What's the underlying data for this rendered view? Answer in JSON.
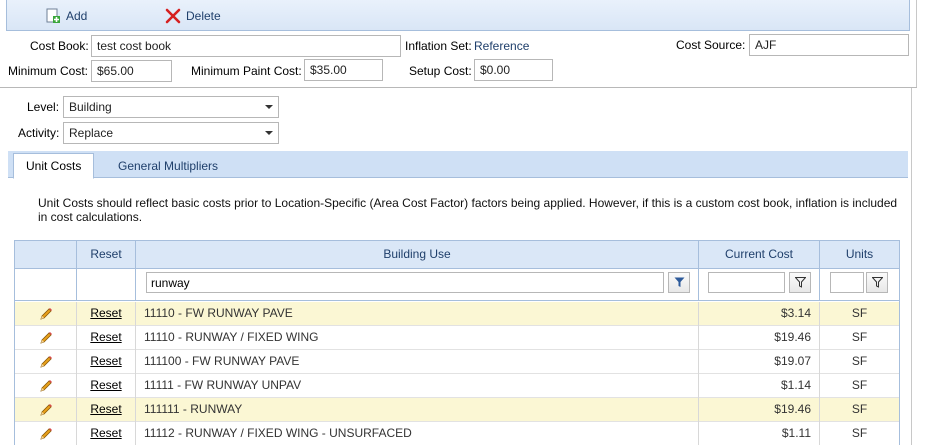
{
  "toolbar": {
    "add_label": "Add",
    "delete_label": "Delete"
  },
  "form": {
    "cost_book_label": "Cost Book:",
    "cost_book_value": "test cost book",
    "inflation_set_label": "Inflation Set:",
    "inflation_set_value": "Reference",
    "cost_source_label": "Cost Source:",
    "cost_source_value": "AJF",
    "minimum_cost_label": "Minimum Cost:",
    "minimum_cost_value": "$65.00",
    "minimum_paint_cost_label": "Minimum Paint Cost:",
    "minimum_paint_cost_value": "$35.00",
    "setup_cost_label": "Setup Cost:",
    "setup_cost_value": "$0.00",
    "level_label": "Level:",
    "level_value": "Building",
    "activity_label": "Activity:",
    "activity_value": "Replace"
  },
  "tabs": [
    {
      "label": "Unit Costs",
      "active": true
    },
    {
      "label": "General Multipliers",
      "active": false
    }
  ],
  "note": "Unit Costs should reflect basic costs prior to Location-Specific (Area Cost Factor) factors being applied. However, if this is a custom cost book, inflation is included in cost calculations.",
  "grid": {
    "columns": {
      "reset": "Reset",
      "building_use": "Building Use",
      "current_cost": "Current Cost",
      "units": "Units"
    },
    "filters": {
      "building_use": "runway",
      "current_cost": "",
      "units": ""
    },
    "rows": [
      {
        "reset": "Reset",
        "building_use": "11110 - FW RUNWAY PAVE",
        "current_cost": "$3.14",
        "units": "SF",
        "highlighted": true
      },
      {
        "reset": "Reset",
        "building_use": "11110 - RUNWAY / FIXED WING",
        "current_cost": "$19.46",
        "units": "SF",
        "highlighted": false
      },
      {
        "reset": "Reset",
        "building_use": "111100 - FW RUNWAY PAVE",
        "current_cost": "$19.07",
        "units": "SF",
        "highlighted": false
      },
      {
        "reset": "Reset",
        "building_use": "11111 - FW RUNWAY UNPAV",
        "current_cost": "$1.14",
        "units": "SF",
        "highlighted": false
      },
      {
        "reset": "Reset",
        "building_use": "111111 - RUNWAY",
        "current_cost": "$19.46",
        "units": "SF",
        "highlighted": true
      },
      {
        "reset": "Reset",
        "building_use": "11112 - RUNWAY / FIXED WING - UNSURFACED",
        "current_cost": "$1.11",
        "units": "SF",
        "highlighted": false
      }
    ]
  },
  "colors": {
    "highlight_row": "#fbf7d4",
    "header_bg": "#dae7f7",
    "accent": "#1f3f6b"
  }
}
